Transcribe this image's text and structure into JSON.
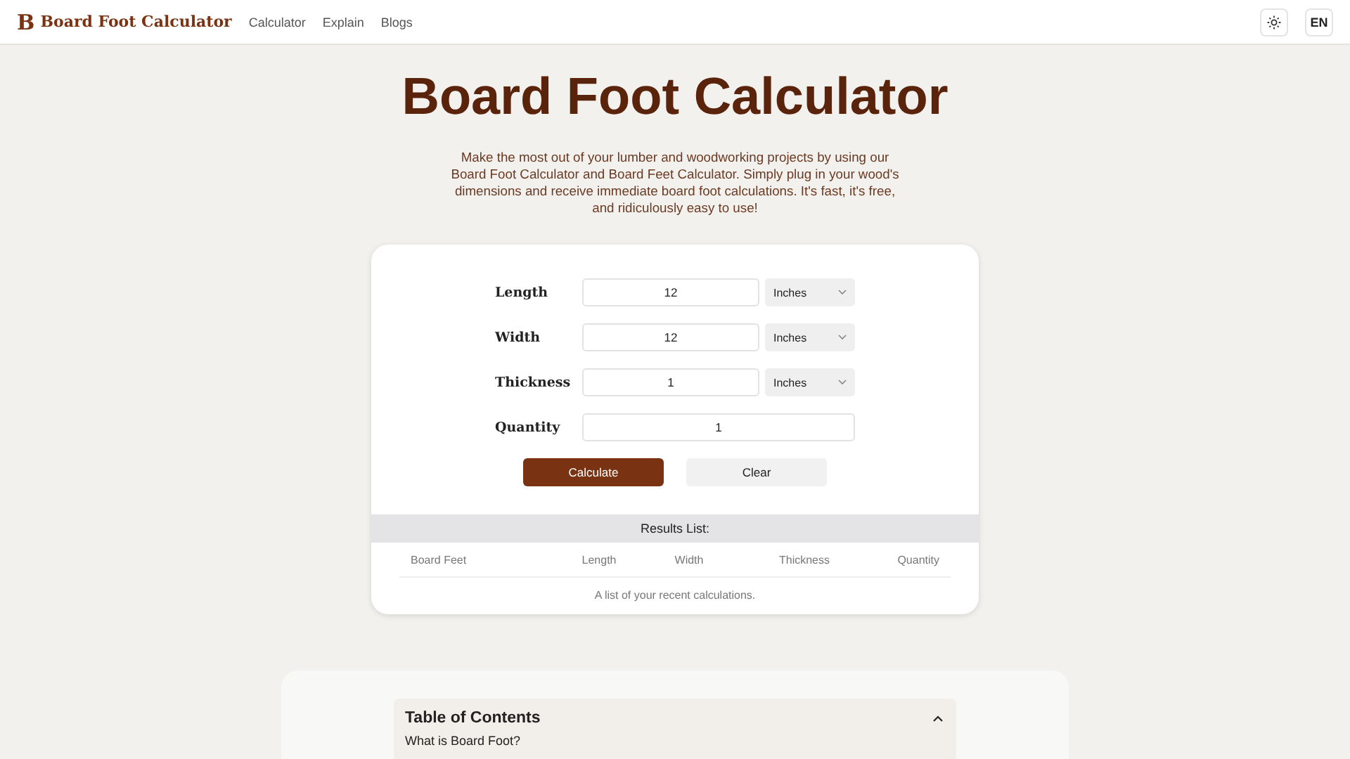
{
  "header": {
    "logo_letter": "B",
    "brand": "Board Foot Calculator",
    "nav": [
      "Calculator",
      "Explain",
      "Blogs"
    ],
    "language": "EN"
  },
  "hero": {
    "title": "Board Foot Calculator",
    "description": "Make the most out of your lumber and woodworking projects by using our Board Foot Calculator and Board Feet Calculator. Simply plug in your wood's dimensions and receive immediate board foot calculations. It's fast, it's free, and ridiculously easy to use!"
  },
  "fields": [
    {
      "label": "Length",
      "value": "12",
      "unit": "Inches"
    },
    {
      "label": "Width",
      "value": "12",
      "unit": "Inches"
    },
    {
      "label": "Thickness",
      "value": "1",
      "unit": "Inches"
    },
    {
      "label": "Quantity",
      "value": "1"
    }
  ],
  "buttons": [
    {
      "label": "Calculate",
      "kind": "primary"
    },
    {
      "label": "Clear",
      "kind": "secondary"
    }
  ],
  "results": {
    "title": "Results List:",
    "columns": [
      "Board Feet",
      "Length",
      "Width",
      "Thickness",
      "Quantity"
    ],
    "caption": "A list of your recent calculations."
  },
  "toc": {
    "title": "Table of Contents",
    "expanded": true,
    "items": [
      "What is Board Foot?"
    ]
  }
}
